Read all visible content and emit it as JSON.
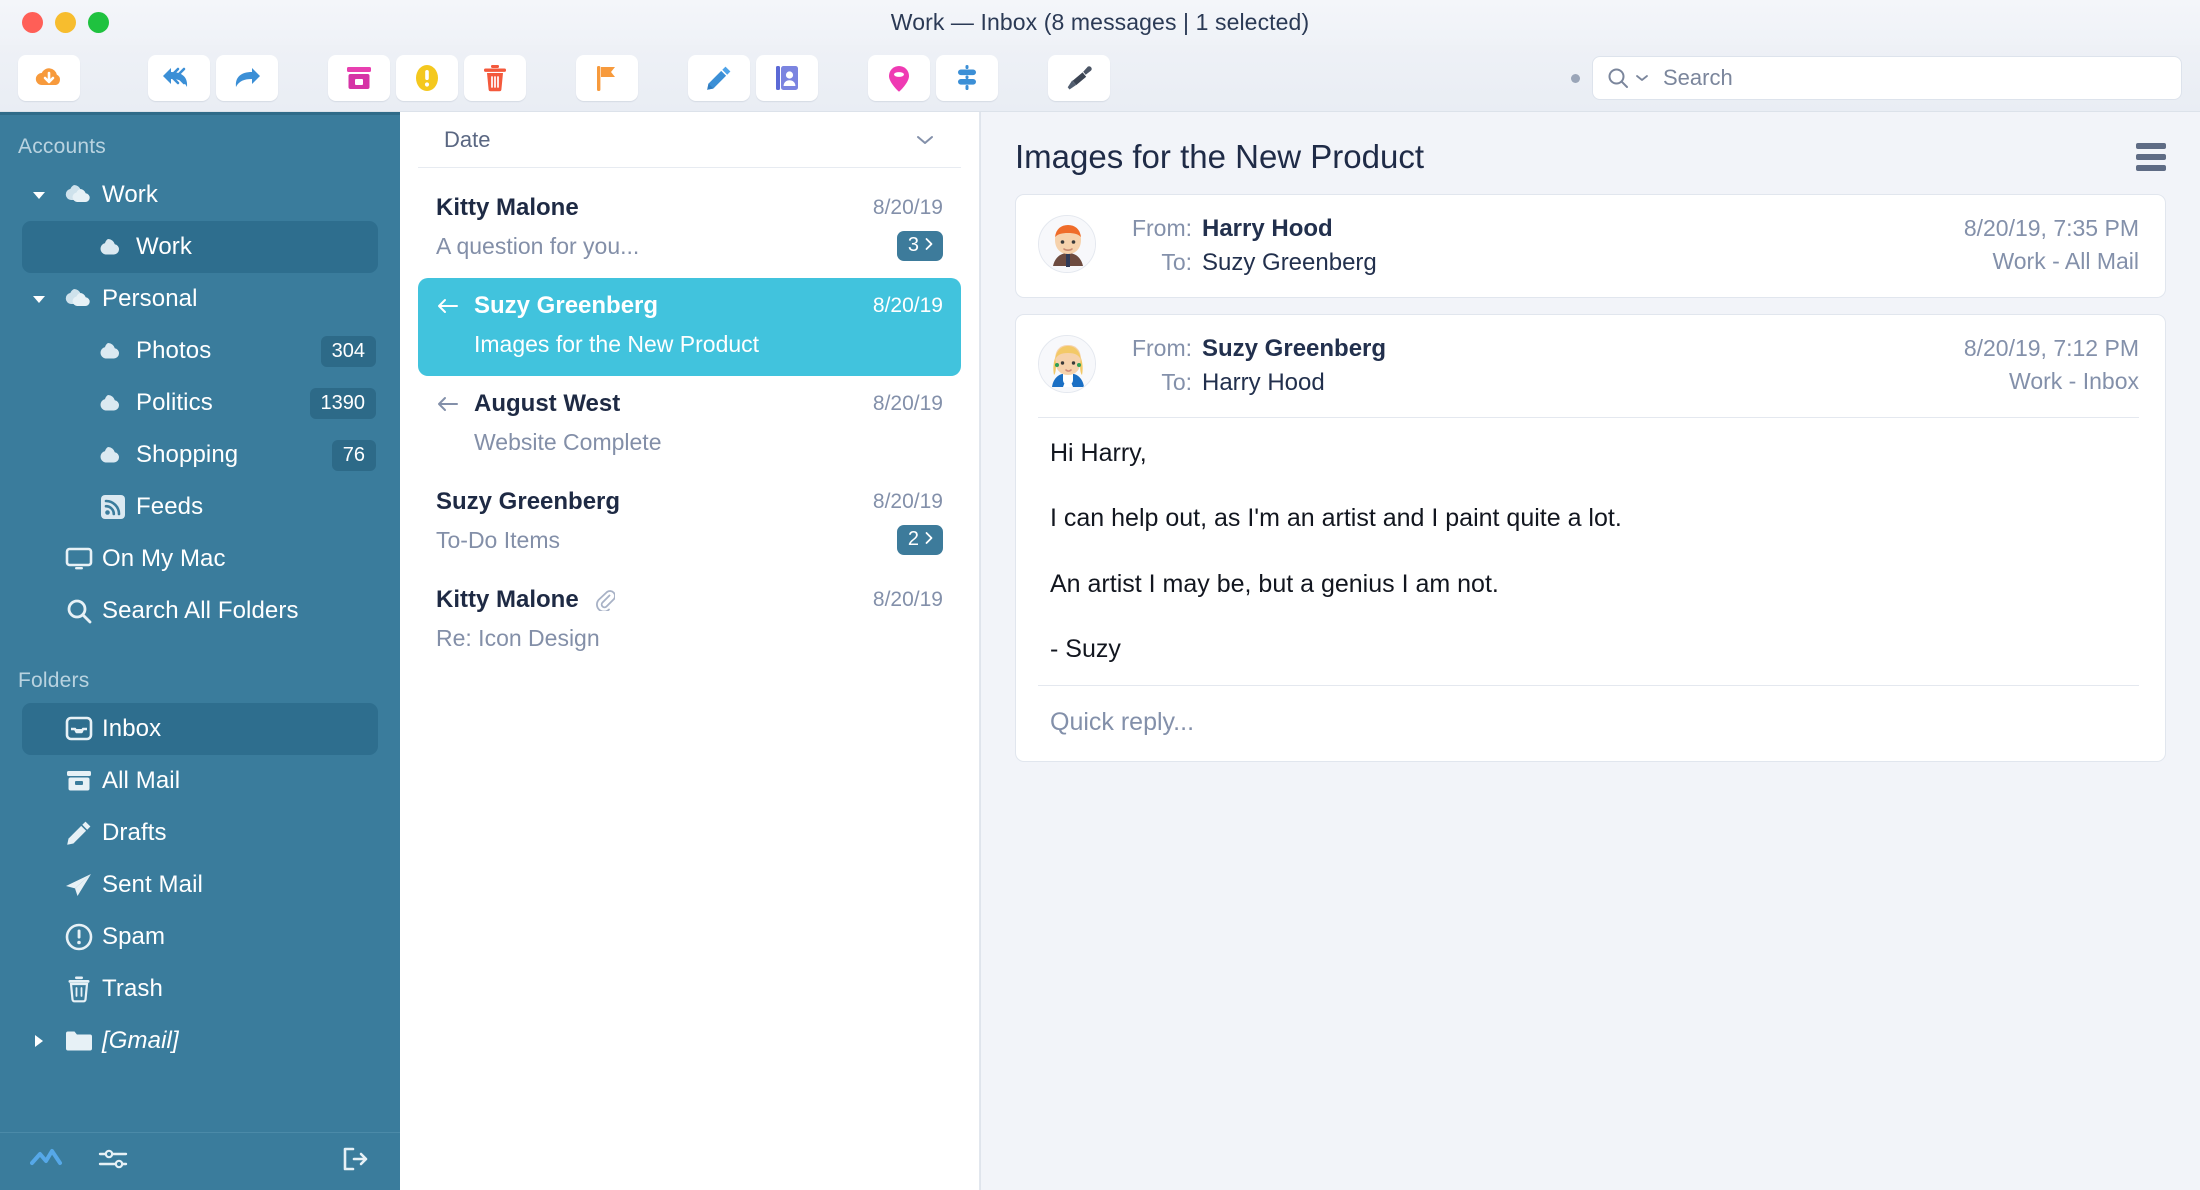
{
  "window": {
    "title": "Work — Inbox (8 messages | 1 selected)",
    "traffic": {
      "close": "close-button",
      "minimize": "minimize-button",
      "zoom": "zoom-button"
    }
  },
  "toolbar": {
    "buttons": [
      {
        "name": "get-mail-button",
        "icon": "cloud-download-icon"
      },
      {
        "name": "reply-all-button",
        "icon": "reply-all-icon"
      },
      {
        "name": "forward-button",
        "icon": "forward-arrow-icon"
      },
      {
        "name": "archive-button",
        "icon": "archive-box-icon"
      },
      {
        "name": "mark-spam-button",
        "icon": "exclamation-icon"
      },
      {
        "name": "delete-button",
        "icon": "trash-icon"
      },
      {
        "name": "flag-button",
        "icon": "flag-icon"
      },
      {
        "name": "compose-button",
        "icon": "pencil-icon"
      },
      {
        "name": "contacts-button",
        "icon": "address-book-icon"
      },
      {
        "name": "tag-button",
        "icon": "tag-pin-icon"
      },
      {
        "name": "filter-button",
        "icon": "filter-sliders-icon"
      },
      {
        "name": "cleanup-button",
        "icon": "paintbrush-icon"
      }
    ],
    "search": {
      "placeholder": "Search",
      "icon": "search-icon",
      "chevron": "chevron-down-icon"
    }
  },
  "sidebar": {
    "accounts_header": "Accounts",
    "folders_header": "Folders",
    "accounts": [
      {
        "label": "Work",
        "icon": "cloud-stack-icon",
        "disclosure": "triangle-down-icon",
        "level": 0,
        "selected": false,
        "badge": ""
      },
      {
        "label": "Work",
        "icon": "cloud-icon",
        "disclosure": "",
        "level": 1,
        "selected": true,
        "badge": ""
      },
      {
        "label": "Personal",
        "icon": "cloud-stack-icon",
        "disclosure": "triangle-down-icon",
        "level": 0,
        "selected": false,
        "badge": ""
      },
      {
        "label": "Photos",
        "icon": "cloud-icon",
        "disclosure": "",
        "level": 1,
        "selected": false,
        "badge": "304"
      },
      {
        "label": "Politics",
        "icon": "cloud-icon",
        "disclosure": "",
        "level": 1,
        "selected": false,
        "badge": "1390"
      },
      {
        "label": "Shopping",
        "icon": "cloud-icon",
        "disclosure": "",
        "level": 1,
        "selected": false,
        "badge": "76"
      },
      {
        "label": "Feeds",
        "icon": "rss-icon",
        "disclosure": "",
        "level": 1,
        "selected": false,
        "badge": ""
      },
      {
        "label": "On My Mac",
        "icon": "monitor-icon",
        "disclosure": "",
        "level": 0,
        "selected": false,
        "badge": ""
      },
      {
        "label": "Search All Folders",
        "icon": "search-icon",
        "disclosure": "",
        "level": 0,
        "selected": false,
        "badge": ""
      }
    ],
    "folders": [
      {
        "label": "Inbox",
        "icon": "inbox-icon",
        "disclosure": "",
        "selected": true,
        "italic": false
      },
      {
        "label": "All Mail",
        "icon": "archive-box-icon",
        "disclosure": "",
        "selected": false,
        "italic": false
      },
      {
        "label": "Drafts",
        "icon": "pencil-icon",
        "disclosure": "",
        "selected": false,
        "italic": false
      },
      {
        "label": "Sent Mail",
        "icon": "paper-plane-icon",
        "disclosure": "",
        "selected": false,
        "italic": false
      },
      {
        "label": "Spam",
        "icon": "exclamation-circle-icon",
        "disclosure": "",
        "selected": false,
        "italic": false
      },
      {
        "label": "Trash",
        "icon": "trash-icon",
        "disclosure": "",
        "selected": false,
        "italic": false
      },
      {
        "label": "[Gmail]",
        "icon": "folder-icon",
        "disclosure": "triangle-right-icon",
        "selected": false,
        "italic": true
      }
    ],
    "bottom_bar": [
      {
        "name": "activity-button",
        "icon": "activity-zigzag-icon"
      },
      {
        "name": "settings-button",
        "icon": "sliders-icon"
      },
      {
        "name": "logout-button",
        "icon": "logout-icon"
      }
    ]
  },
  "message_list": {
    "sort_label": "Date",
    "sort_icon": "chevron-down-icon",
    "rows": [
      {
        "sender": "Kitty Malone",
        "subject": "A question for you...",
        "date": "8/20/19",
        "count": "3",
        "selected": false,
        "replied": false,
        "attachment": false
      },
      {
        "sender": "Suzy Greenberg",
        "subject": "Images for the New Product",
        "date": "8/20/19",
        "count": "",
        "selected": true,
        "replied": true,
        "attachment": false
      },
      {
        "sender": "August West",
        "subject": "Website Complete",
        "date": "8/20/19",
        "count": "",
        "selected": false,
        "replied": true,
        "attachment": false
      },
      {
        "sender": "Suzy Greenberg",
        "subject": "To-Do Items",
        "date": "8/20/19",
        "count": "2",
        "selected": false,
        "replied": false,
        "attachment": false
      },
      {
        "sender": "Kitty Malone",
        "subject": "Re: Icon Design",
        "date": "8/20/19",
        "count": "",
        "selected": false,
        "replied": false,
        "attachment": true
      }
    ]
  },
  "reader": {
    "title": "Images for the New Product",
    "menu_icon": "hamburger-menu-icon",
    "messages": [
      {
        "avatar": "harry-avatar",
        "from_label": "From:",
        "from_value": "Harry Hood",
        "to_label": "To:",
        "to_value": "Suzy Greenberg",
        "timestamp": "8/20/19, 7:35 PM",
        "mailbox": "Work - All Mail",
        "body": [],
        "quick_reply": "",
        "expanded": false
      },
      {
        "avatar": "suzy-avatar",
        "from_label": "From:",
        "from_value": "Suzy Greenberg",
        "to_label": "To:",
        "to_value": "Harry Hood",
        "timestamp": "8/20/19, 7:12 PM",
        "mailbox": "Work - Inbox",
        "body": [
          "Hi Harry,",
          "I can help out, as I'm an artist and I paint quite a lot.",
          "An artist I may be, but a genius I am not.",
          "- Suzy"
        ],
        "quick_reply": "Quick reply...",
        "expanded": true
      }
    ]
  },
  "colors": {
    "sidebar_bg": "#3a7c9c",
    "sidebar_selected": "#2e6e8e",
    "row_selected": "#41c3dd",
    "badge": "#2d6a88",
    "accent_blue": "#3b8fd6",
    "pink": "#e83fb0",
    "orange": "#f79a3c",
    "red": "#f4593c",
    "yellow": "#f4c81e"
  }
}
